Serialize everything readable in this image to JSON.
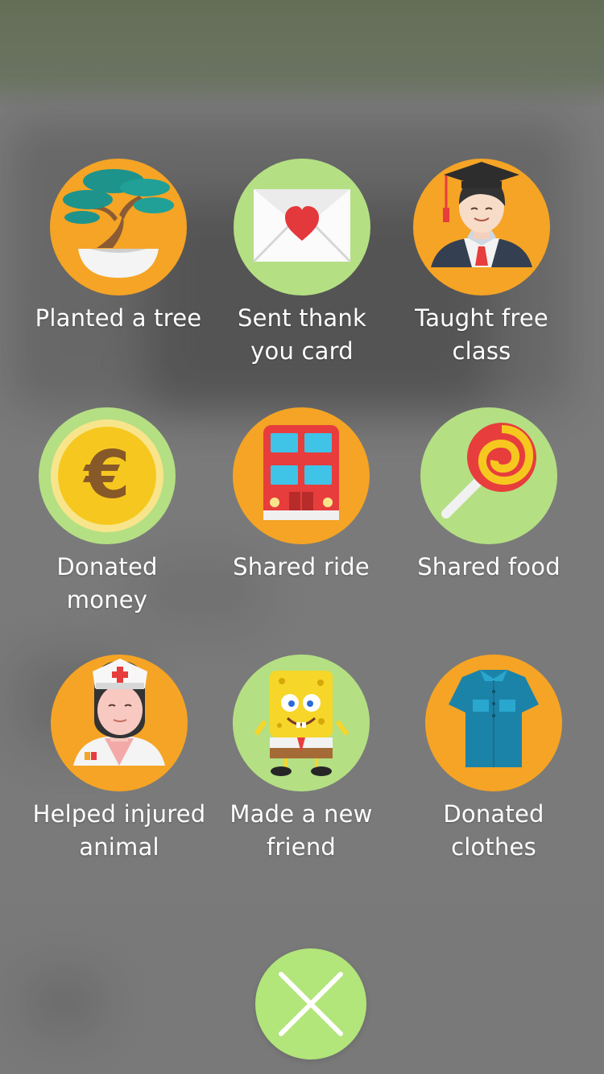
{
  "items": [
    {
      "label": "Planted a tree",
      "icon": "bonsai-tree-icon",
      "background": "#f5a425"
    },
    {
      "label": "Sent thank you card",
      "icon": "thank-you-card-icon",
      "background": "#b5df83"
    },
    {
      "label": "Taught free class",
      "icon": "graduate-icon",
      "background": "#f5a425"
    },
    {
      "label": "Donated money",
      "icon": "euro-coin-icon",
      "background": "#b5df83"
    },
    {
      "label": "Shared ride",
      "icon": "bus-icon",
      "background": "#f5a425"
    },
    {
      "label": "Shared food",
      "icon": "lollipop-icon",
      "background": "#b5df83"
    },
    {
      "label": "Helped injured animal",
      "icon": "nurse-icon",
      "background": "#f5a425"
    },
    {
      "label": "Made a new friend",
      "icon": "sponge-character-icon",
      "background": "#b5df83"
    },
    {
      "label": "Donated clothes",
      "icon": "shirt-icon",
      "background": "#f5a425"
    }
  ],
  "close": {
    "icon": "close-icon",
    "background": "#b2e57a"
  }
}
